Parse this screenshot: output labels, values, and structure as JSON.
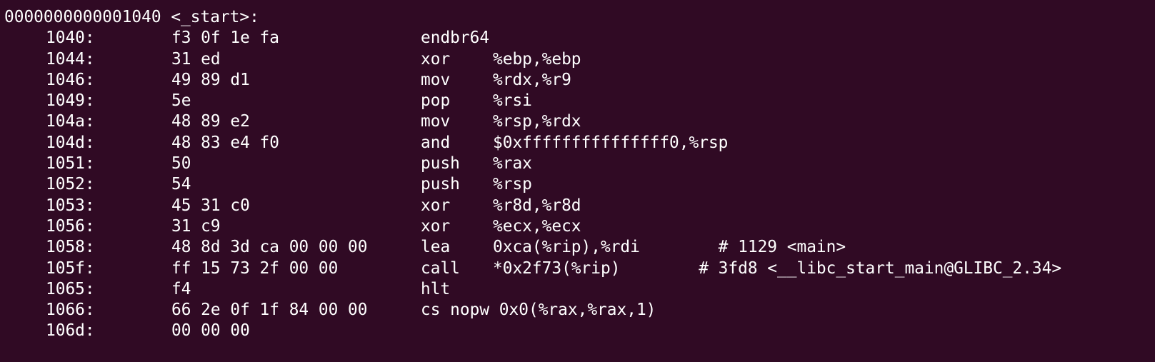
{
  "header": {
    "label": "0000000000001040 <_start>:"
  },
  "instructions": [
    {
      "addr": "1040:",
      "bytes": "f3 0f 1e fa",
      "mnemonic": "endbr64",
      "operands": "",
      "comment": ""
    },
    {
      "addr": "1044:",
      "bytes": "31 ed",
      "mnemonic": "xor",
      "operands": "%ebp,%ebp",
      "comment": ""
    },
    {
      "addr": "1046:",
      "bytes": "49 89 d1",
      "mnemonic": "mov",
      "operands": "%rdx,%r9",
      "comment": ""
    },
    {
      "addr": "1049:",
      "bytes": "5e",
      "mnemonic": "pop",
      "operands": "%rsi",
      "comment": ""
    },
    {
      "addr": "104a:",
      "bytes": "48 89 e2",
      "mnemonic": "mov",
      "operands": "%rsp,%rdx",
      "comment": ""
    },
    {
      "addr": "104d:",
      "bytes": "48 83 e4 f0",
      "mnemonic": "and",
      "operands": "$0xfffffffffffffff0,%rsp",
      "comment": ""
    },
    {
      "addr": "1051:",
      "bytes": "50",
      "mnemonic": "push",
      "operands": "%rax",
      "comment": ""
    },
    {
      "addr": "1052:",
      "bytes": "54",
      "mnemonic": "push",
      "operands": "%rsp",
      "comment": ""
    },
    {
      "addr": "1053:",
      "bytes": "45 31 c0",
      "mnemonic": "xor",
      "operands": "%r8d,%r8d",
      "comment": ""
    },
    {
      "addr": "1056:",
      "bytes": "31 c9",
      "mnemonic": "xor",
      "operands": "%ecx,%ecx",
      "comment": ""
    },
    {
      "addr": "1058:",
      "bytes": "48 8d 3d ca 00 00 00",
      "mnemonic": "lea",
      "operands": "0xca(%rip),%rdi",
      "comment": "        # 1129 <main>"
    },
    {
      "addr": "105f:",
      "bytes": "ff 15 73 2f 00 00",
      "mnemonic": "call",
      "operands": "*0x2f73(%rip)",
      "comment": "        # 3fd8 <__libc_start_main@GLIBC_2.34>"
    },
    {
      "addr": "1065:",
      "bytes": "f4",
      "mnemonic": "hlt",
      "operands": "",
      "comment": ""
    },
    {
      "addr": "1066:",
      "bytes": "66 2e 0f 1f 84 00 00",
      "mnemonic": "cs nopw 0x0(%rax,%rax,1)",
      "operands": "",
      "comment": ""
    },
    {
      "addr": "106d:",
      "bytes": "00 00 00",
      "mnemonic": "",
      "operands": "",
      "comment": ""
    }
  ]
}
